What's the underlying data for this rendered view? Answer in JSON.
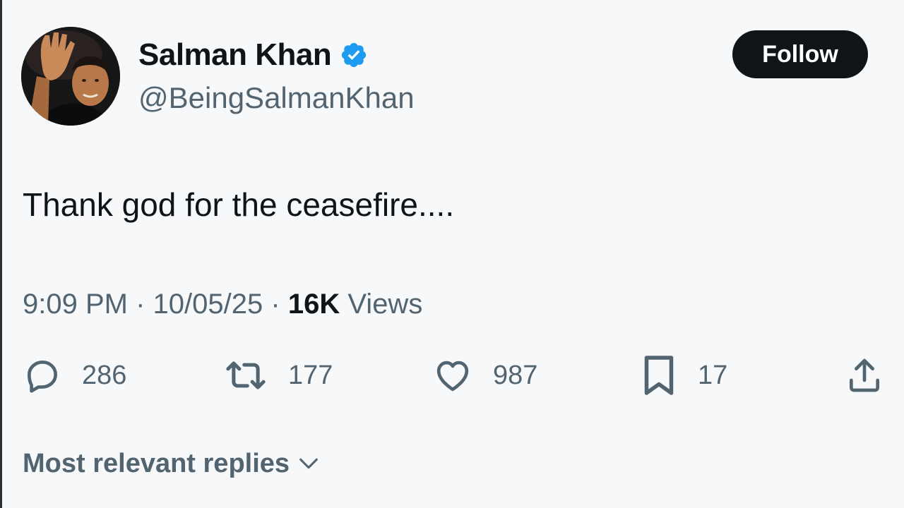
{
  "author": {
    "display_name": "Salman Khan",
    "handle": "@BeingSalmanKhan",
    "verified_color": "#1d9bf0"
  },
  "follow_label": "Follow",
  "tweet": {
    "text": "Thank god for the ceasefire....",
    "time": "9:09 PM",
    "date": "10/05/25",
    "separator": "·",
    "views_count": "16K",
    "views_label": "Views"
  },
  "actions": {
    "replies": "286",
    "reposts": "177",
    "likes": "987",
    "bookmarks": "17"
  },
  "replies_filter": {
    "label": "Most relevant replies"
  },
  "colors": {
    "background": "#f7f8fa",
    "text_primary": "#0f1419",
    "text_secondary": "#536471",
    "follow_bg": "#0f1419"
  },
  "icons": {
    "reply": "reply-icon",
    "repost": "repost-icon",
    "like": "heart-icon",
    "bookmark": "bookmark-icon",
    "share": "share-icon",
    "verified": "verified-badge-icon",
    "dropdown": "chevron-down-icon"
  }
}
